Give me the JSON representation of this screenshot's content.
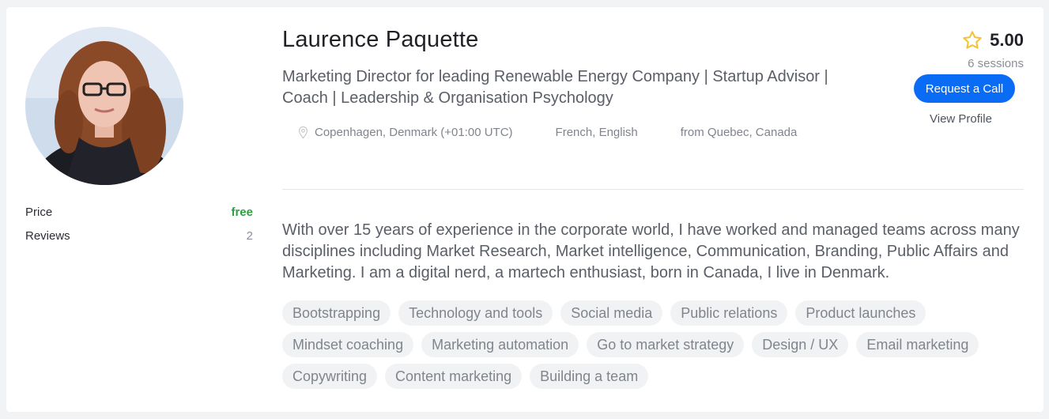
{
  "profile": {
    "name": "Laurence Paquette",
    "headline": "Marketing Director for leading Renewable Energy Company | Startup Advisor | Coach | Leadership & Organisation Psychology",
    "location": "Copenhagen, Denmark (+01:00 UTC)",
    "languages": "French, English",
    "origin": "from Quebec, Canada",
    "bio": "With over 15 years of experience in the corporate world, I have worked and managed teams across many disciplines including Market Research, Market intelligence, Communication, Branding, Public Affairs and Marketing. I am a digital nerd, a martech enthusiast, born in Canada, I live in Denmark."
  },
  "stats": {
    "price_label": "Price",
    "price_value": "free",
    "reviews_label": "Reviews",
    "reviews_value": "2"
  },
  "rating": {
    "score": "5.00",
    "sessions": "6 sessions",
    "icon": "star-icon"
  },
  "actions": {
    "request_call": "Request a Call",
    "view_profile": "View Profile"
  },
  "tags": [
    "Bootstrapping",
    "Technology and tools",
    "Social media",
    "Public relations",
    "Product launches",
    "Mindset coaching",
    "Marketing automation",
    "Go to market strategy",
    "Design / UX",
    "Email marketing",
    "Copywriting",
    "Content marketing",
    "Building a team"
  ],
  "colors": {
    "accent": "#0a6cf5",
    "free": "#2e9e45",
    "star": "#f2c233",
    "tag_bg": "#f1f2f4"
  }
}
